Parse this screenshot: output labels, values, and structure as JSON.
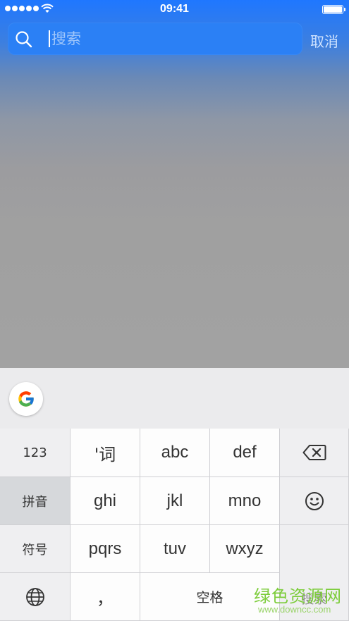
{
  "status_bar": {
    "time": "09:41",
    "signal_icon": "signal-dots-icon",
    "wifi_icon": "wifi-icon",
    "battery_icon": "battery-icon"
  },
  "search": {
    "placeholder": "搜索",
    "value": "",
    "icon": "search-icon",
    "cancel_label": "取消"
  },
  "keyboard": {
    "suggest_icon": "google-logo-icon",
    "rows": [
      [
        "123",
        "'词",
        "abc",
        "def",
        "backspace"
      ],
      [
        "拼音",
        "ghi",
        "jkl",
        "mno",
        "emoji"
      ],
      [
        "符号",
        "pqrs",
        "tuv",
        "wxyz"
      ],
      [
        "globe",
        "，",
        "空格"
      ]
    ],
    "key_123": "123",
    "key_word": "'词",
    "key_abc": "abc",
    "key_def": "def",
    "key_pinyin": "拼音",
    "key_ghi": "ghi",
    "key_jkl": "jkl",
    "key_mno": "mno",
    "key_symbols": "符号",
    "key_pqrs": "pqrs",
    "key_tuv": "tuv",
    "key_wxyz": "wxyz",
    "key_comma": "，",
    "key_space": "空格",
    "key_search": "搜索",
    "backspace_icon": "backspace-icon",
    "emoji_icon": "emoji-icon",
    "globe_icon": "globe-icon"
  },
  "watermark": {
    "text": "绿色资源网",
    "url": "www.downcc.com"
  },
  "colors": {
    "accent": "#2b80f5",
    "keyboard_bg": "#e9e9eb",
    "watermark_green": "#7ccc3a"
  }
}
